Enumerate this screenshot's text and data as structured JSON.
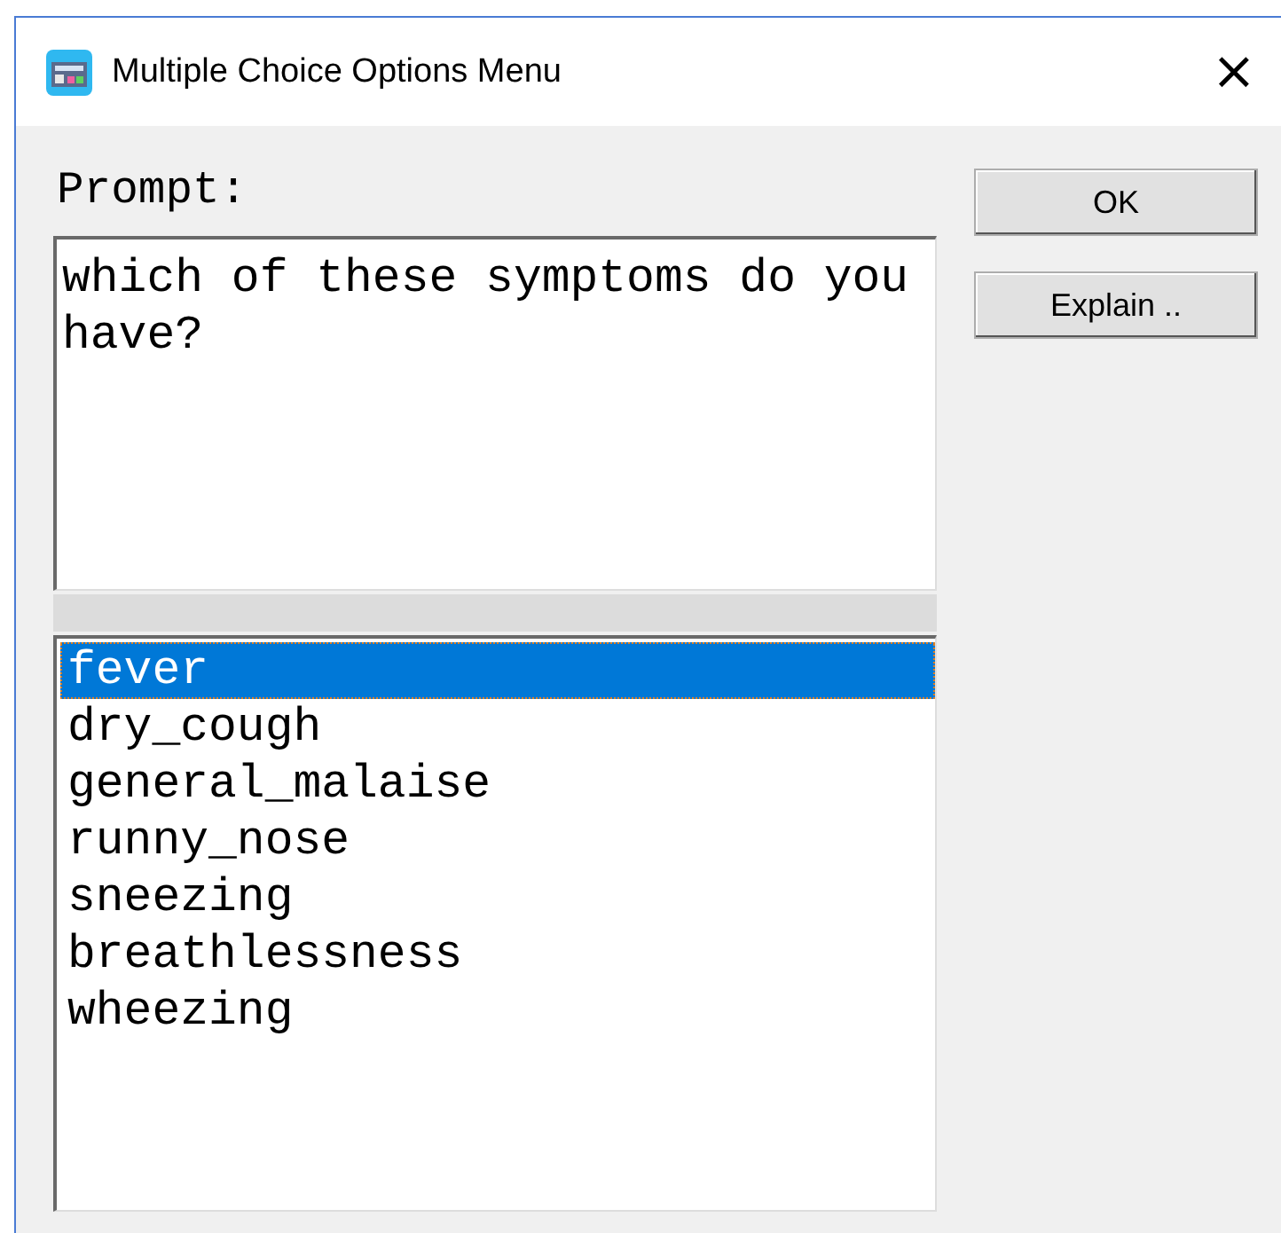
{
  "window": {
    "title": "Multiple Choice Options Menu",
    "close": "×"
  },
  "prompt": {
    "label": "Prompt:",
    "value": "which of these symptoms do you have?"
  },
  "options": [
    {
      "label": "fever",
      "selected": true
    },
    {
      "label": "dry_cough",
      "selected": false
    },
    {
      "label": "general_malaise",
      "selected": false
    },
    {
      "label": "runny_nose",
      "selected": false
    },
    {
      "label": "sneezing",
      "selected": false
    },
    {
      "label": "breathlessness",
      "selected": false
    },
    {
      "label": "wheezing",
      "selected": false
    }
  ],
  "buttons": [
    "OK",
    "Explain .."
  ]
}
